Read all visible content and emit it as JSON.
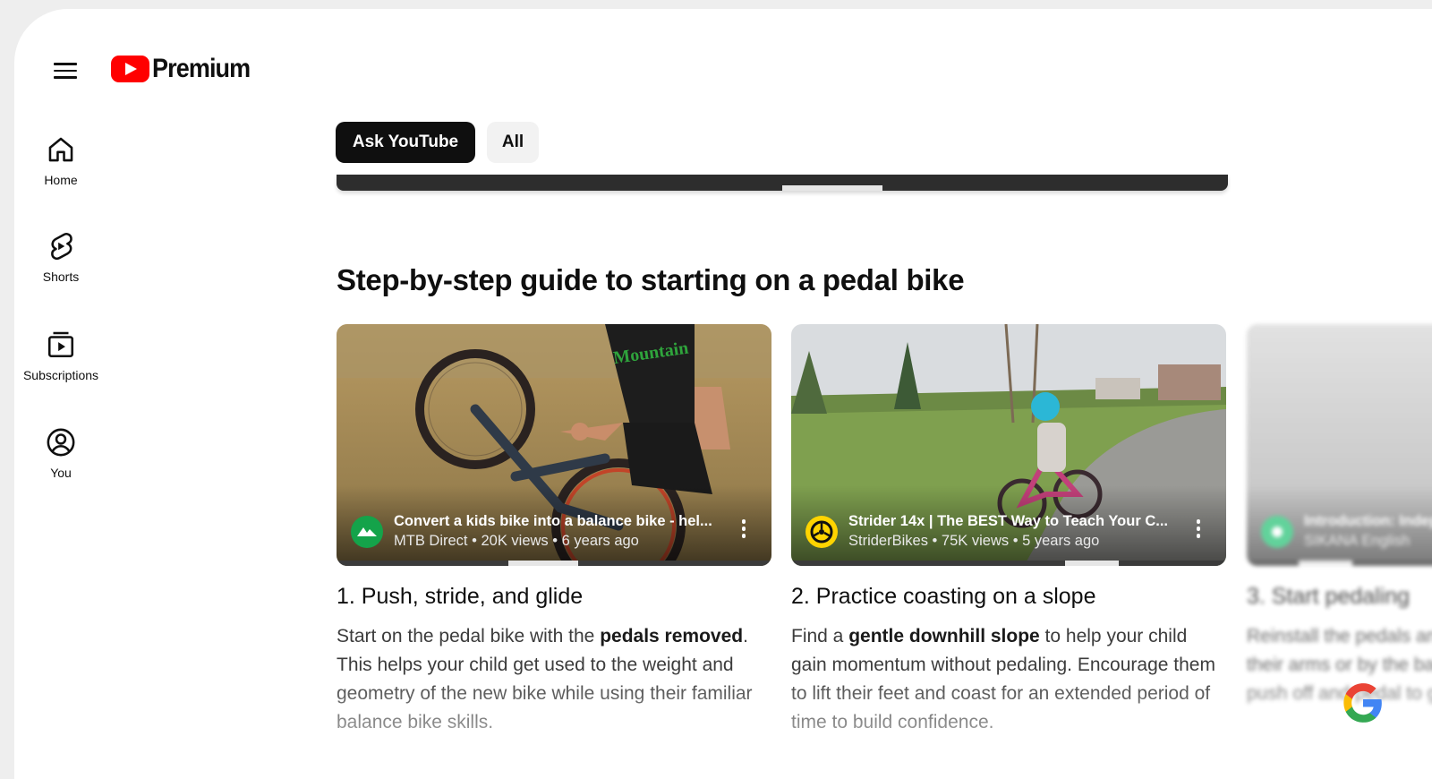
{
  "app": {
    "brand": "Premium",
    "accent": "#ff0000"
  },
  "sidebar": {
    "items": [
      {
        "label": "Home",
        "icon": "home-icon"
      },
      {
        "label": "Shorts",
        "icon": "shorts-icon"
      },
      {
        "label": "Subscriptions",
        "icon": "subscriptions-icon"
      },
      {
        "label": "You",
        "icon": "account-icon"
      }
    ]
  },
  "chips": [
    {
      "label": "Ask YouTube",
      "selected": true
    },
    {
      "label": "All",
      "selected": false
    }
  ],
  "section": {
    "title": "Step-by-step guide to starting on a pedal bike"
  },
  "cards": [
    {
      "video_title": "Convert a kids bike into a balance bike - hel...",
      "channel": "MTB Direct",
      "views": "20K views",
      "age": "6 years ago",
      "step_title": "1. Push, stride, and glide",
      "desc_parts": [
        "Start on the pedal bike with the ",
        "pedals removed",
        ". This helps your child get used to the weight and geometry of the new bike while using their familiar balance bike skills."
      ]
    },
    {
      "video_title": "Strider 14x | The BEST Way to Teach Your C...",
      "channel": "StriderBikes",
      "views": "75K views",
      "age": "5 years ago",
      "step_title": "2. Practice coasting on a slope",
      "desc_parts": [
        "Find a ",
        "gentle downhill slope",
        " to help your child gain momentum without pedaling. Encourage them to lift their feet and coast for an extended period of time to build confidence."
      ]
    },
    {
      "video_title": "Introduction: Independent Pedaling",
      "channel": "SIKANA English",
      "step_title": "3. Start pedaling",
      "desc_text": "Reinstall the pedals and support them by holding their arms or by the back of the bike. Have them push off and pedal to generate momentum."
    }
  ],
  "separator": "•"
}
